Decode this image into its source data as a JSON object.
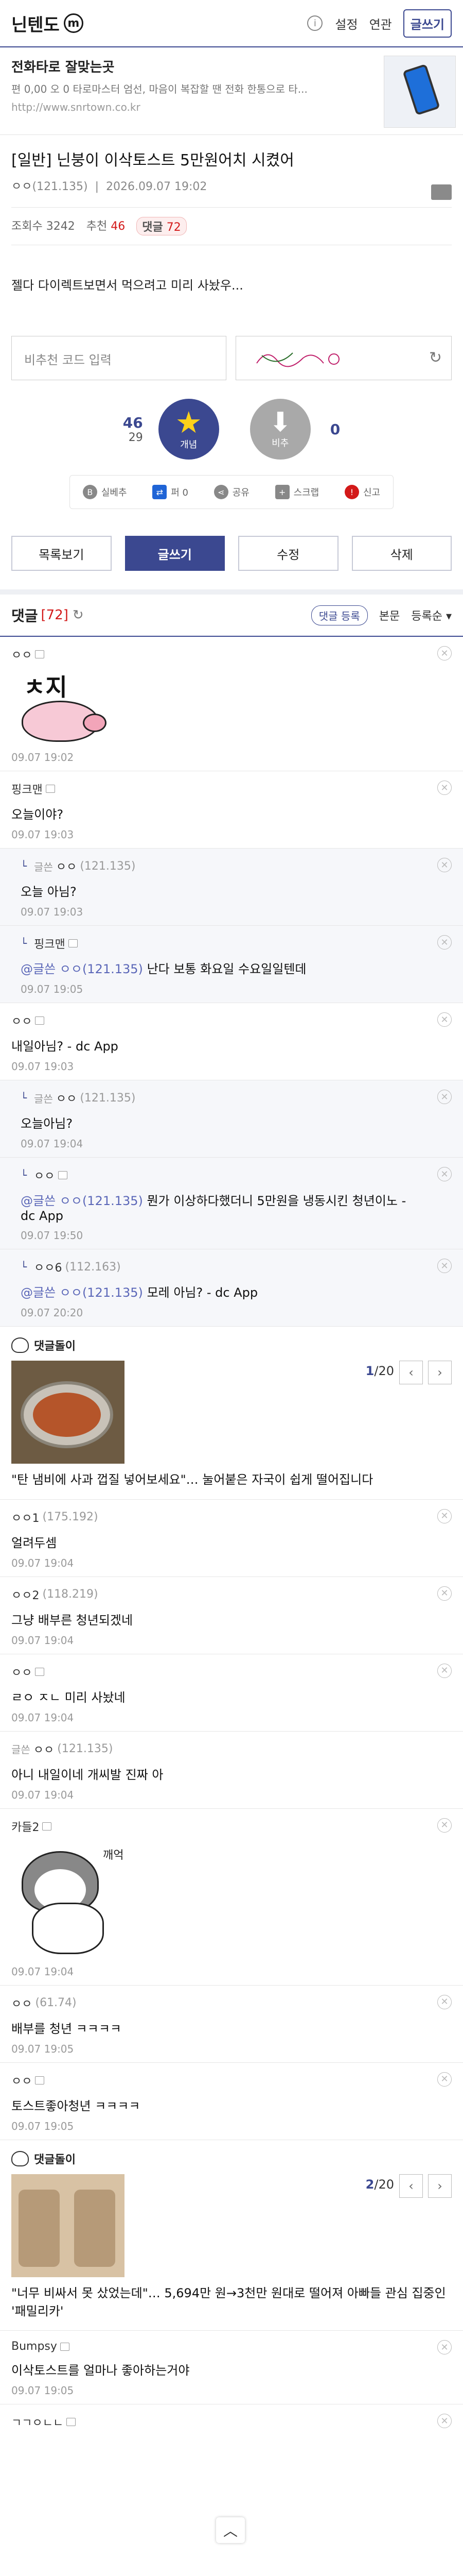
{
  "header": {
    "logo_text": "닌텐도",
    "logo_mark": "m",
    "info_icon": "i",
    "settings": "설정",
    "gallery": "연관",
    "write": "글쓰기"
  },
  "ad": {
    "title": "전화타로 잘맞는곳",
    "desc": "편 0,00 오 0 타로마스터 엄선, 마음이 복잡할 땐 전화 한통으로 타...",
    "url": "http://www.snrtown.co.kr"
  },
  "post": {
    "title": "[일반] 닌붕이 이삭토스트 5만원어치 시켰어",
    "nick": "ㅇㅇ",
    "ip": "(121.135)",
    "date": "2026.09.07 19:02",
    "views_label": "조회수",
    "views": "3242",
    "rec_label": "추천",
    "rec": "46",
    "cmt_label": "댓글",
    "cmt": "72",
    "body": "젤다 다이렉트보면서 먹으려고 미리 사놨우..."
  },
  "recommend": {
    "placeholder": "비추천 코드 입력",
    "up_count": "46",
    "fix_count": "29",
    "up_label": "개념",
    "down_label": "비추",
    "down_count": "0"
  },
  "share": [
    "실베추",
    "퍼 0",
    "공유",
    "스크랩",
    "신고"
  ],
  "buttons": {
    "list": "목록보기",
    "write": "글쓰기",
    "edit": "수정",
    "delete": "삭제"
  },
  "comments_header": {
    "title": "댓글",
    "count": "[72]",
    "refresh": "↻",
    "register": "댓글 등록",
    "body": "본문",
    "order": "등록순 ▾"
  },
  "comments": [
    {
      "nick": "ㅇㅇ",
      "ip": "",
      "dccon_text": "ㅊ지",
      "time": "09.07 19:02"
    },
    {
      "nick": "핑크맨",
      "text": "오늘이야?",
      "time": "09.07 19:03"
    },
    {
      "reply": true,
      "del_label": "글쓴",
      "nick": "ㅇㅇ",
      "ip": "(121.135)",
      "text": "오늘 아님?",
      "time": "09.07 19:03"
    },
    {
      "reply": true,
      "nick": "핑크맨",
      "to": "@글쓴 ㅇㅇ(121.135)",
      "text": "난다 보통 화요일 수요일일텐데",
      "time": "09.07 19:05"
    },
    {
      "nick": "ㅇㅇ",
      "text": "내일아님? - dc App",
      "time": "09.07 19:03"
    },
    {
      "reply": true,
      "del_label": "글쓴",
      "nick": "ㅇㅇ",
      "ip": "(121.135)",
      "text": "오늘아님?",
      "time": "09.07 19:04"
    },
    {
      "reply": true,
      "nick": "ㅇㅇ",
      "to": "@글쓴 ㅇㅇ(121.135)",
      "text": "뭔가 이상하다했더니 5만원을 냉동시킨 청년이노 - dc App",
      "time": "09.07 19:50"
    },
    {
      "reply": true,
      "nick": "ㅇㅇ6",
      "ip": "(112.163)",
      "to": "@글쓴 ㅇㅇ(121.135)",
      "text": "모레 아님? - dc App",
      "time": "09.07 20:20"
    }
  ],
  "dcbest1": {
    "title": "댓글돌이",
    "page": "1",
    "total": "/20",
    "caption": "\"탄 냄비에 사과 껍질 넣어보세요\"… 눌어붙은 자국이 쉽게 떨어집니다"
  },
  "comments2": [
    {
      "nick": "ㅇㅇ1",
      "ip": "(175.192)",
      "text": "얼려두셈",
      "time": "09.07 19:04"
    },
    {
      "nick": "ㅇㅇ2",
      "ip": "(118.219)",
      "text": "그냥 배부른 청년되겠네",
      "time": "09.07 19:04"
    },
    {
      "nick": "ㅇㅇ",
      "text": "ㄹㅇ ㅈㄴ 미리 사놨네",
      "time": "09.07 19:04"
    },
    {
      "del_label": "글쓴",
      "nick": "ㅇㅇ",
      "ip": "(121.135)",
      "text": "아니 내일이네 개씨발 진짜 아",
      "time": "09.07 19:04"
    },
    {
      "nick": "카들2",
      "dccon_text": "깨억",
      "time": "09.07 19:04"
    },
    {
      "nick": "ㅇㅇ",
      "ip": "(61.74)",
      "text": "배부를 청년 ㅋㅋㅋㅋ",
      "time": "09.07 19:05"
    },
    {
      "nick": "ㅇㅇ",
      "text": "토스트좋아청년 ㅋㅋㅋㅋ",
      "time": "09.07 19:05"
    }
  ],
  "dcbest2": {
    "title": "댓글돌이",
    "page": "2",
    "total": "/20",
    "caption": "\"너무 비싸서 못 샀었는데\"… 5,694만 원→3천만 원대로 떨어져 아빠들 관심 집중인 '패밀리카'"
  },
  "comments3": [
    {
      "nick": "Bumpsy",
      "text": "이삭토스트를 얼마나 좋아하는거야",
      "time": "09.07 19:05"
    },
    {
      "nick": "ㄱㄱㅇㄴㄴ",
      "text": "",
      "time": ""
    }
  ],
  "fab": "︿"
}
